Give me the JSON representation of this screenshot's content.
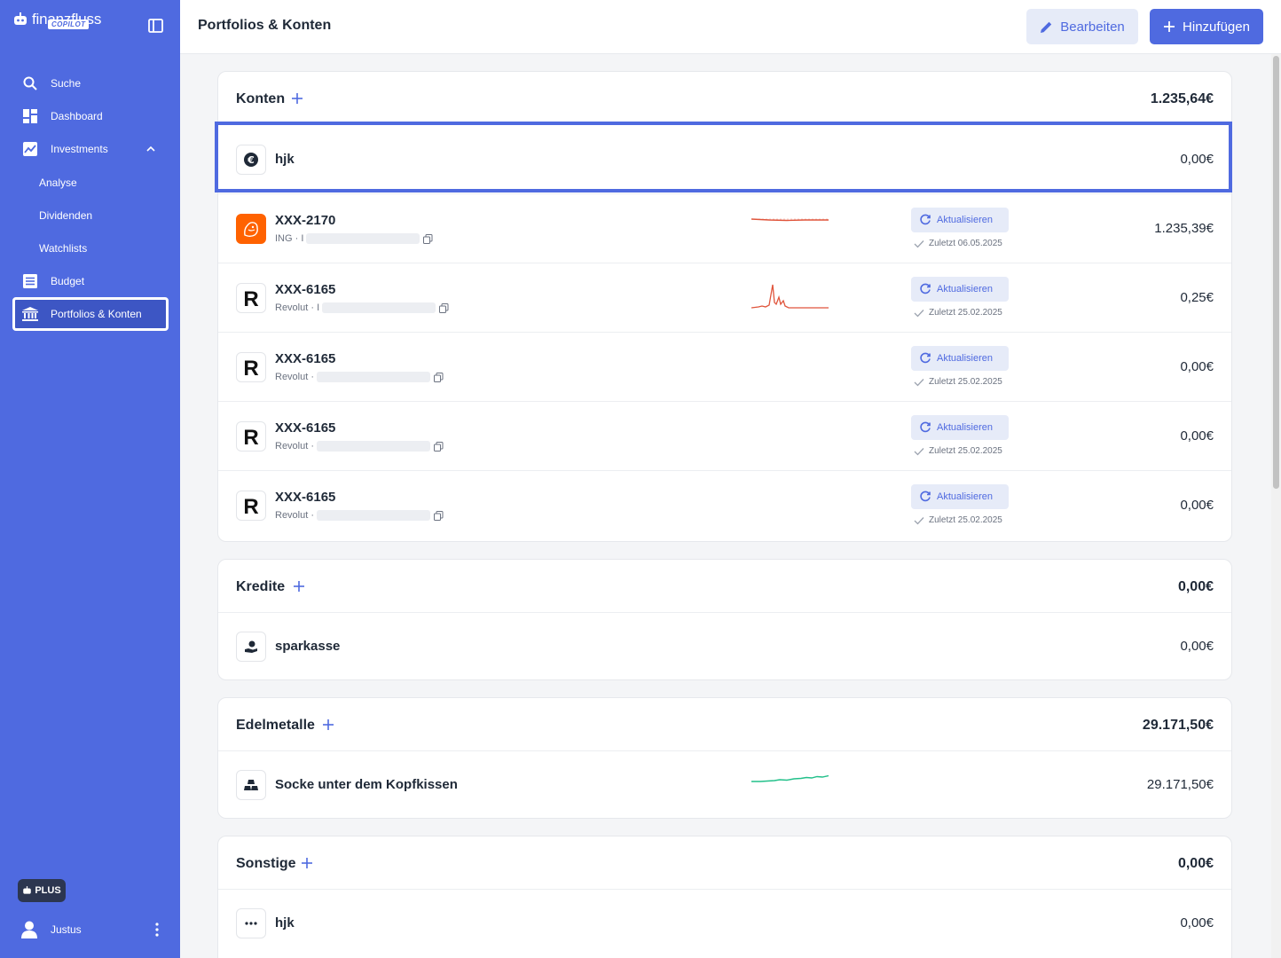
{
  "sidebar": {
    "logo_text": "finanzfluss",
    "logo_badge": "COPILOT",
    "nav": {
      "search": "Suche",
      "dashboard": "Dashboard",
      "investments": "Investments",
      "analyse": "Analyse",
      "dividenden": "Dividenden",
      "watchlists": "Watchlists",
      "budget": "Budget",
      "portfolios": "Portfolios & Konten"
    },
    "plan_badge": "PLUS",
    "user_name": "Justus"
  },
  "header": {
    "title": "Portfolios & Konten",
    "edit_label": "Bearbeiten",
    "add_label": "Hinzufügen"
  },
  "konten": {
    "title": "Konten",
    "total": "1.235,64€",
    "rows": [
      {
        "name": "hjk",
        "value": "0,00€"
      },
      {
        "name": "XXX-2170",
        "sub": "ING · I",
        "value": "1.235,39€",
        "refresh": "Aktualisieren",
        "updated": "Zuletzt 06.05.2025"
      },
      {
        "name": "XXX-6165",
        "sub": "Revolut · I",
        "value": "0,25€",
        "refresh": "Aktualisieren",
        "updated": "Zuletzt 25.02.2025"
      },
      {
        "name": "XXX-6165",
        "sub": "Revolut ·",
        "value": "0,00€",
        "refresh": "Aktualisieren",
        "updated": "Zuletzt 25.02.2025"
      },
      {
        "name": "XXX-6165",
        "sub": "Revolut ·",
        "value": "0,00€",
        "refresh": "Aktualisieren",
        "updated": "Zuletzt 25.02.2025"
      },
      {
        "name": "XXX-6165",
        "sub": "Revolut ·",
        "value": "0,00€",
        "refresh": "Aktualisieren",
        "updated": "Zuletzt 25.02.2025"
      }
    ]
  },
  "kredite": {
    "title": "Kredite",
    "total": "0,00€",
    "rows": [
      {
        "name": "sparkasse",
        "value": "0,00€"
      }
    ]
  },
  "edelmetalle": {
    "title": "Edelmetalle",
    "total": "29.171,50€",
    "rows": [
      {
        "name": "Socke unter dem Kopfkissen",
        "value": "29.171,50€"
      }
    ]
  },
  "sonstige": {
    "title": "Sonstige",
    "total": "0,00€",
    "rows": [
      {
        "name": "hjk",
        "value": "0,00€"
      }
    ]
  },
  "colors": {
    "accent": "#4f6ae0",
    "sidebar_bg": "#4f6ae0",
    "spark_red": "#e0553c",
    "spark_green": "#22c08a",
    "ing_orange": "#ff6200"
  }
}
